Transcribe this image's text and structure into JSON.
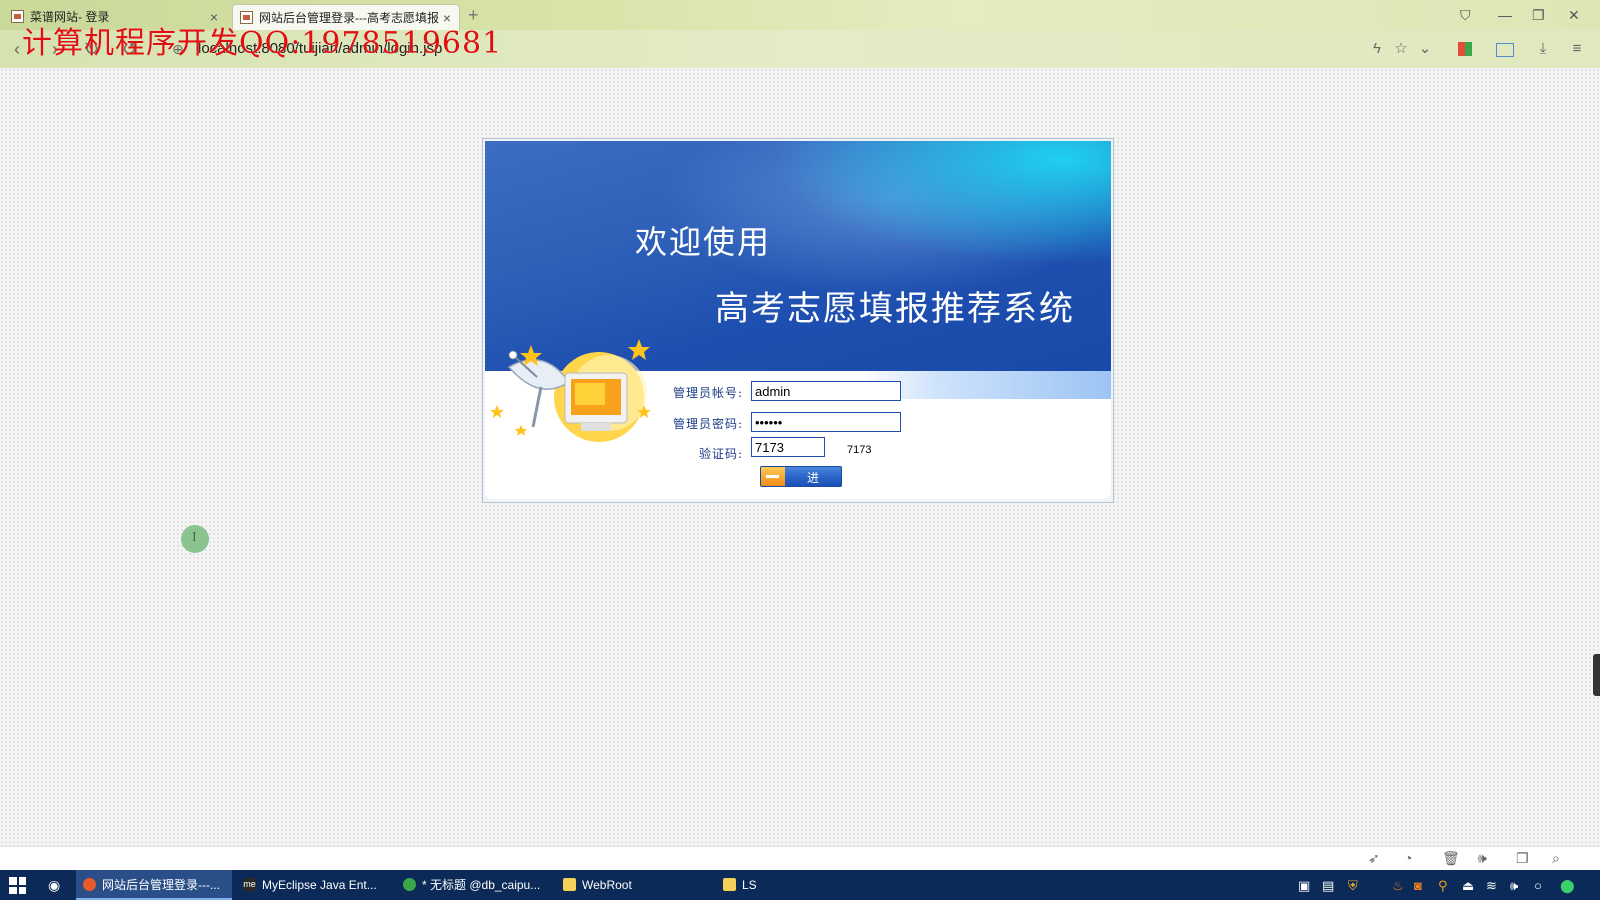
{
  "browser": {
    "tabs": [
      {
        "label": "菜谱网站- 登录",
        "active": false
      },
      {
        "label": "网站后台管理登录---高考志愿填报",
        "active": true
      }
    ],
    "new_tab": "+",
    "url": "localhost:8080/tuijian/admin/login.jsp",
    "watermark": "计算机程序开发QQ:1978519681"
  },
  "login": {
    "welcome": "欢迎使用",
    "system_title": "高考志愿填报推荐系统",
    "username_label": "管理员帐号:",
    "username_value": "admin",
    "password_label": "管理员密码:",
    "password_value": "••••••",
    "captcha_label": "验证码:",
    "captcha_input": "7173",
    "captcha_code": "7173",
    "submit_label": "进 入"
  },
  "taskbar": {
    "apps": [
      {
        "label": "网站后台管理登录---...",
        "active": true,
        "color": "#e85a2a"
      },
      {
        "label": "MyEclipse Java Ent...",
        "active": false,
        "color": "#2a2a2a"
      },
      {
        "label": "* 无标题 @db_caipu...",
        "active": false,
        "color": "#3aa84a"
      },
      {
        "label": "WebRoot",
        "active": false,
        "color": "#f5d15a"
      },
      {
        "label": "LS",
        "active": false,
        "color": "#f5d15a"
      }
    ]
  },
  "colors": {
    "banner_blue": "#1e4fb0",
    "input_border": "#1f4fb1",
    "label_blue": "#1a3b86",
    "watermark_red": "#e01010",
    "taskbar": "#0b2a57"
  }
}
